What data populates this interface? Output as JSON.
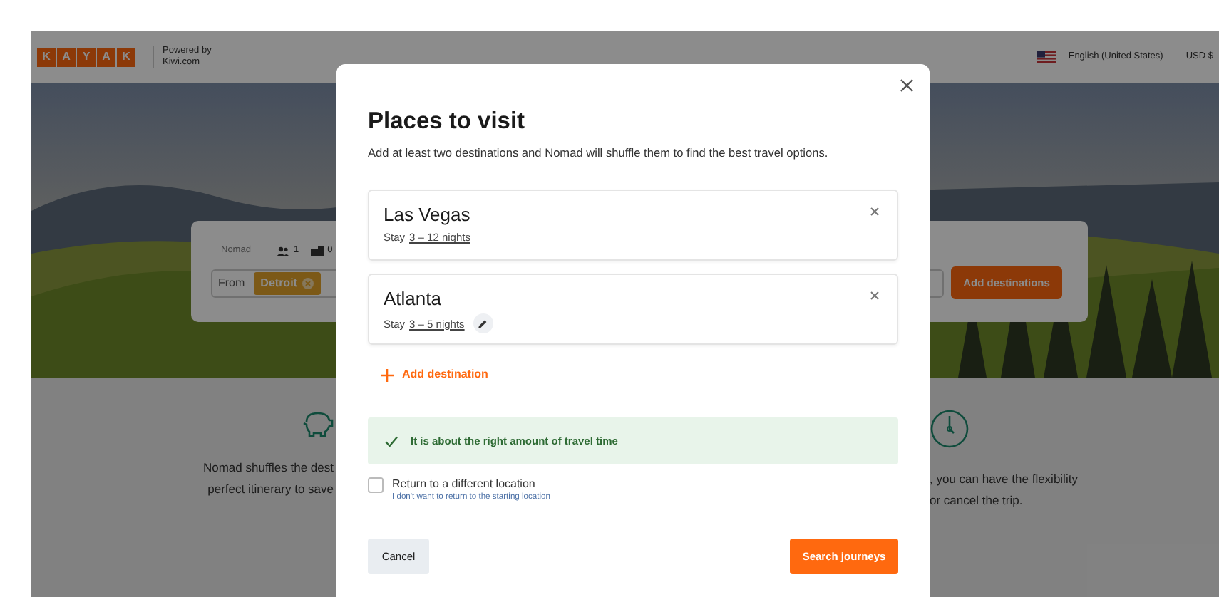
{
  "header": {
    "logo": [
      "K",
      "A",
      "Y",
      "A",
      "K"
    ],
    "powered_by": "Powered by",
    "partner": "Kiwi.com",
    "language": "English (United States)",
    "currency": "USD $"
  },
  "search_card": {
    "mode": "Nomad",
    "adults": "1",
    "children": "0",
    "from_label": "From",
    "from_city": "Detroit",
    "button": "Add destinations"
  },
  "features": [
    {
      "kind": "savings",
      "lines": [
        "Nomad shuffles the dest",
        "perfect itinerary to save"
      ]
    },
    {
      "kind": "time",
      "lines": [
        ", you can have the flexibility",
        "or cancel the trip."
      ]
    }
  ],
  "modal": {
    "title": "Places to visit",
    "subtitle": "Add at least two destinations and Nomad will shuffle them to find the best travel options.",
    "destinations": [
      {
        "city": "Las Vegas",
        "stay_label": "Stay",
        "nights": "3 – 12 nights",
        "hovered": false
      },
      {
        "city": "Atlanta",
        "stay_label": "Stay",
        "nights": "3 – 5 nights",
        "hovered": true
      }
    ],
    "add_label": "Add destination",
    "notice": "It is about the right amount of travel time",
    "return_option": {
      "label": "Return to a different location",
      "hint": "I don't want to return to the starting location",
      "checked": false
    },
    "cancel": "Cancel",
    "submit": "Search journeys"
  }
}
